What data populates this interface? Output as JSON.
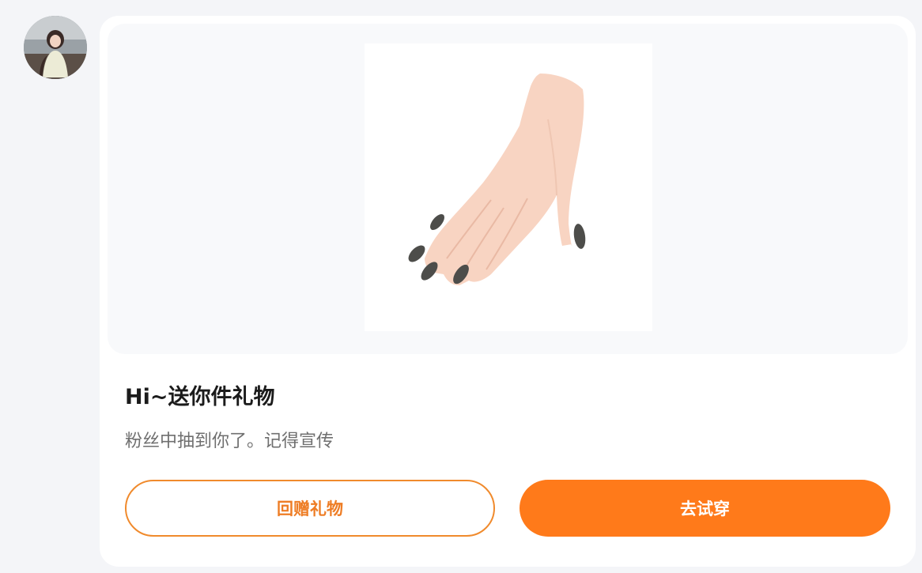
{
  "avatar": {
    "alt": "user-avatar-photo"
  },
  "product": {
    "image": "hand-with-dark-nails-illustration"
  },
  "gift": {
    "title": "Hi~送你件礼物",
    "message": "粉丝中抽到你了。记得宣传"
  },
  "actions": {
    "gift_back_label": "回赠礼物",
    "try_on_label": "去试穿"
  },
  "colors": {
    "accent": "#ff7a1a",
    "accent_outline": "#f08a2c",
    "page_background": "#f4f5f8",
    "card_background": "#ffffff"
  }
}
